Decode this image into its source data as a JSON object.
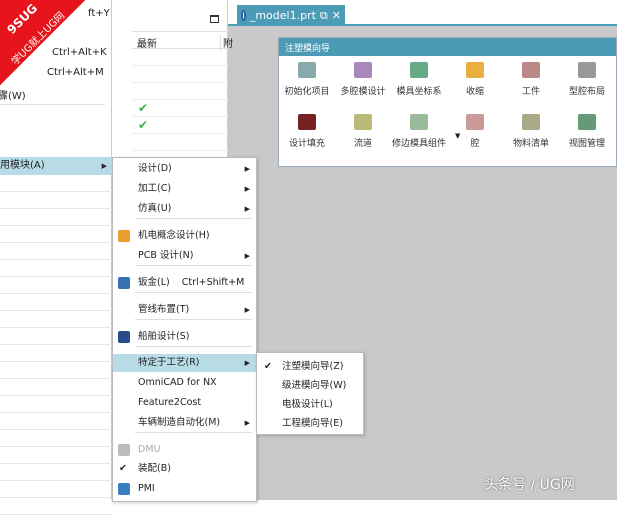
{
  "left_menu": {
    "items": [
      {
        "label": "ft+Y"
      },
      {
        "label": "Ctrl+Alt+K"
      },
      {
        "label": "Ctrl+Alt+M"
      },
      {
        "label": "骤(W)"
      },
      {
        "label": "用模块(A)"
      }
    ]
  },
  "navigator": {
    "column": "最新",
    "column2": "附"
  },
  "tab": {
    "title": "_model1.prt"
  },
  "dialog": {
    "title": "注塑模向导",
    "tools": [
      "初始化项目",
      "多腔模设计",
      "模具坐标系",
      "收缩",
      "工件",
      "型腔布局",
      "设计填充",
      "流道",
      "修边模具组件",
      "腔",
      "物料清单",
      "视图管理"
    ]
  },
  "submenu": {
    "items": [
      {
        "label": "设计(D)",
        "arrow": true
      },
      {
        "label": "加工(C)",
        "arrow": true
      },
      {
        "label": "仿真(U)",
        "arrow": true
      },
      {
        "label": "机电概念设计(H)",
        "icon": "mechatronics-icon"
      },
      {
        "label": "PCB 设计(N)",
        "arrow": true
      },
      {
        "label": "钣金(L)",
        "shortcut": "Ctrl+Shift+M",
        "icon": "sheet-metal-icon"
      },
      {
        "label": "管线布置(T)",
        "arrow": true
      },
      {
        "label": "船舶设计(S)",
        "icon": "ship-icon"
      },
      {
        "label": "特定于工艺(R)",
        "arrow": true
      },
      {
        "label": "OmniCAD for NX"
      },
      {
        "label": "Feature2Cost"
      },
      {
        "label": "车辆制造自动化(M)",
        "arrow": true
      },
      {
        "label": "DMU",
        "icon": "dmu-icon"
      },
      {
        "label": "装配(B)",
        "check": true
      },
      {
        "label": "PMI",
        "icon": "pmi-icon"
      }
    ]
  },
  "process_menu": {
    "items": [
      {
        "label": "注塑模向导(Z)",
        "check": true
      },
      {
        "label": "级进模向导(W)"
      },
      {
        "label": "电极设计(L)"
      },
      {
        "label": "工程模向导(E)"
      }
    ]
  },
  "watermark": {
    "text": "9SUG 学UG就上UG网",
    "footer": "头条号 / UG网"
  },
  "colors": {
    "accent": "#4b9bb6",
    "highlight": "#b8dce6"
  }
}
